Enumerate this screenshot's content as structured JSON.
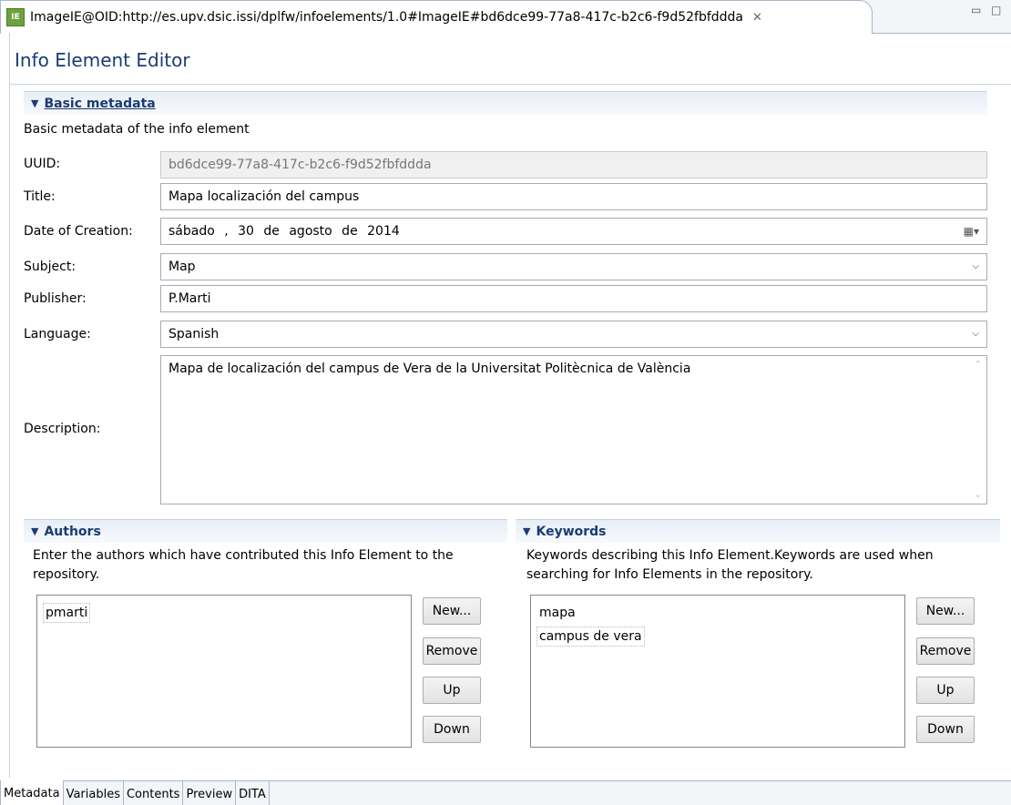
{
  "editor_tab": {
    "title": "ImageIE@OID:http://es.upv.dsic.issi/dplfw/infoelements/1.0#ImageIE#bd6dce99-77a8-417c-b2c6-f9d52fbfddda",
    "icon_text": "IE",
    "close_glyph": "✕",
    "minimize_glyph": "▭",
    "maximize_glyph": "□"
  },
  "form": {
    "title": "Info Element Editor"
  },
  "basic": {
    "header": "Basic metadata",
    "description": "Basic metadata of the info element",
    "uuid": {
      "label": "UUID:",
      "value": "bd6dce99-77a8-417c-b2c6-f9d52fbfddda"
    },
    "title": {
      "label": "Title:",
      "value": "Mapa localización del campus"
    },
    "date": {
      "label": "Date of Creation:",
      "value": "sábado , 30 de agosto de 2014"
    },
    "subject": {
      "label": "Subject:",
      "value": "Map"
    },
    "publisher": {
      "label": "Publisher:",
      "value": "P.Marti"
    },
    "language": {
      "label": "Language:",
      "value": "Spanish"
    },
    "description_field": {
      "label": "Description:",
      "value": "Mapa de localización del campus de Vera de la Universitat Politècnica de València"
    }
  },
  "authors": {
    "header": "Authors",
    "description": "Enter the authors which have contributed this Info Element to the repository.",
    "items": [
      "pmarti"
    ],
    "buttons": {
      "new": "New...",
      "remove": "Remove",
      "up": "Up",
      "down": "Down"
    }
  },
  "keywords": {
    "header": "Keywords",
    "description": "Keywords describing this Info Element.Keywords are used when searching for Info Elements in the repository.",
    "items": [
      "mapa",
      "campus de vera"
    ],
    "buttons": {
      "new": "New...",
      "remove": "Remove",
      "up": "Up",
      "down": "Down"
    }
  },
  "page_tabs": [
    "Metadata",
    "Variables",
    "Contents",
    "Preview",
    "DITA"
  ]
}
